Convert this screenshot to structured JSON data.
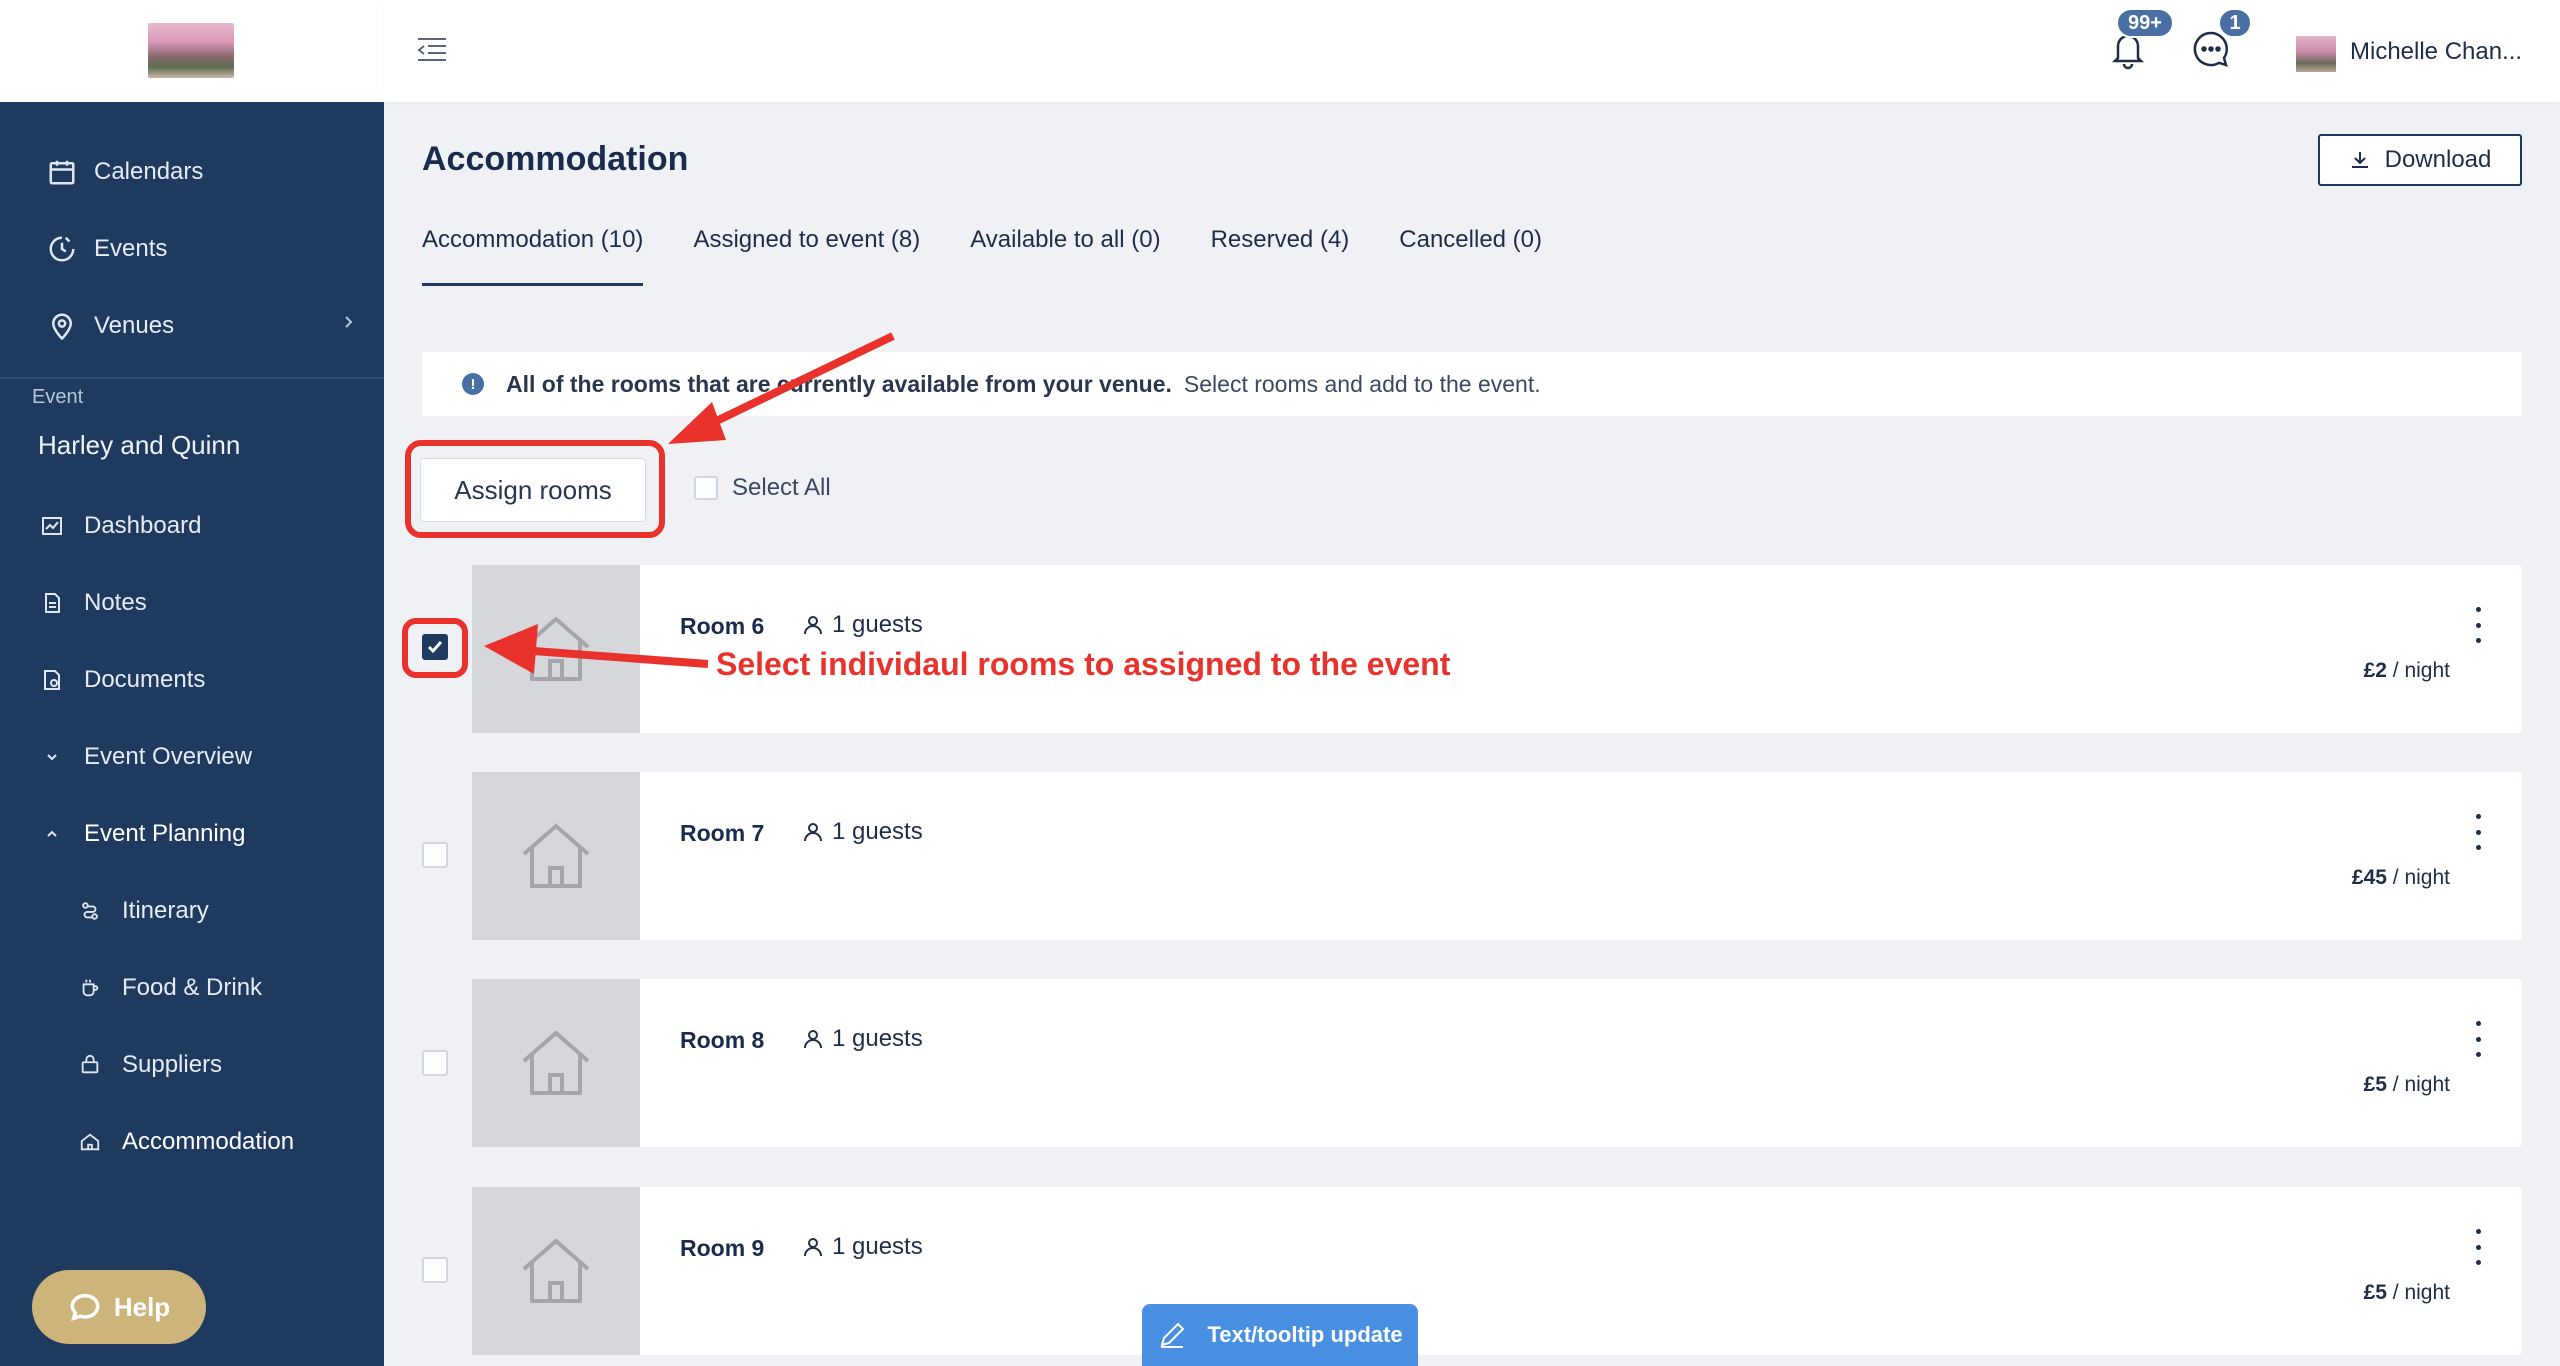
{
  "header": {
    "user_name": "Michelle Chan...",
    "notifications_badge": "99+",
    "messages_badge": "1"
  },
  "sidebar": {
    "top_items": [
      {
        "label": "Calendars",
        "icon": "calendar-icon"
      },
      {
        "label": "Events",
        "icon": "clock-icon"
      },
      {
        "label": "Venues",
        "icon": "location-pin-icon"
      }
    ],
    "section_label": "Event",
    "event_name": "Harley and Quinn",
    "event_items": [
      {
        "label": "Dashboard",
        "icon": "chart-icon"
      },
      {
        "label": "Notes",
        "icon": "note-icon"
      },
      {
        "label": "Documents",
        "icon": "document-icon"
      },
      {
        "label": "Event Overview",
        "icon": "chevron-down-icon"
      },
      {
        "label": "Event Planning",
        "icon": "chevron-up-icon"
      }
    ],
    "planning_items": [
      {
        "label": "Itinerary",
        "icon": "route-icon"
      },
      {
        "label": "Food & Drink",
        "icon": "cup-icon"
      },
      {
        "label": "Suppliers",
        "icon": "bag-icon"
      },
      {
        "label": "Accommodation",
        "icon": "home-icon"
      }
    ],
    "help_label": "Help"
  },
  "main": {
    "title": "Accommodation",
    "download_label": "Download",
    "tabs": [
      {
        "label": "Accommodation (10)"
      },
      {
        "label": "Assigned to event (8)"
      },
      {
        "label": "Available to all (0)"
      },
      {
        "label": "Reserved (4)"
      },
      {
        "label": "Cancelled (0)"
      }
    ],
    "info_bold": "All of the rooms that are currently available from your venue.",
    "info_text": "Select rooms and add to the event.",
    "assign_label": "Assign rooms",
    "select_all_label": "Select All",
    "rooms": [
      {
        "name": "Room 6",
        "guests": "1 guests",
        "price": "£2",
        "unit": " / night",
        "checked": true
      },
      {
        "name": "Room 7",
        "guests": "1 guests",
        "price": "£45",
        "unit": " / night",
        "checked": false
      },
      {
        "name": "Room 8",
        "guests": "1 guests",
        "price": "£5",
        "unit": " / night",
        "checked": false
      },
      {
        "name": "Room 9",
        "guests": "1 guests",
        "price": "£5",
        "unit": " / night",
        "checked": false
      }
    ]
  },
  "annotation_text": "Select individaul rooms to assigned to the event",
  "tooltip_label": "Text/tooltip update",
  "colors": {
    "sidebar": "#1f3a5f",
    "annotation": "#e8322b",
    "help": "#cdb47a",
    "badge": "#4a6fa5",
    "tooltip": "#4a90e2"
  }
}
